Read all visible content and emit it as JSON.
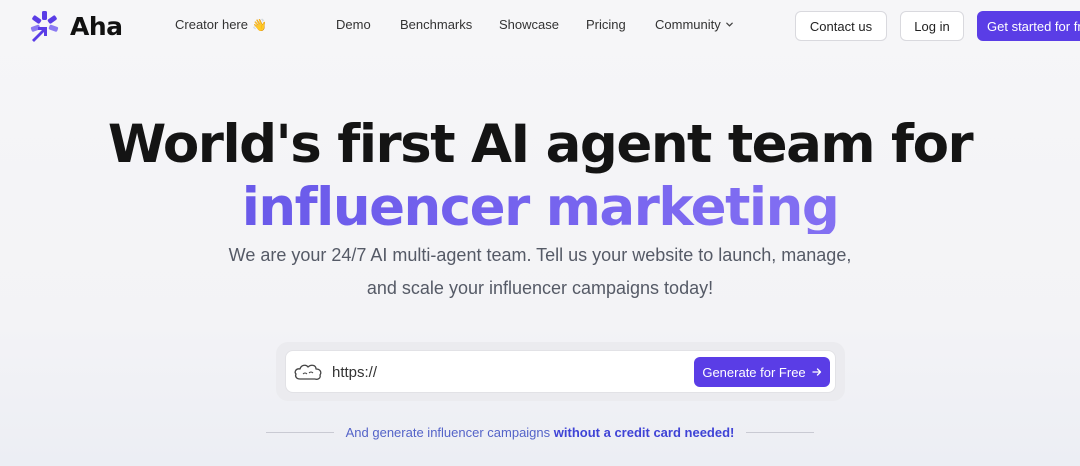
{
  "brand": {
    "name": "Aha"
  },
  "nav": {
    "creator_label": "Creator here",
    "creator_emoji": "👋",
    "demo": "Demo",
    "benchmarks": "Benchmarks",
    "showcase": "Showcase",
    "pricing": "Pricing",
    "community": "Community",
    "contact_button": "Contact us",
    "login_button": "Log in",
    "get_started_button": "Get started for fr"
  },
  "hero": {
    "title_line1": "World's first AI agent team for",
    "title_line2": "influencer marketing",
    "subtitle_line1": "We are your 24/7 AI multi-agent team. Tell us your website to launch, manage,",
    "subtitle_line2": "and scale your influencer campaigns today!"
  },
  "url_form": {
    "value": "https://",
    "icon": "cloud-icon",
    "generate_button": "Generate for Free"
  },
  "footnote": {
    "prefix": "And generate influencer campaigns",
    "emphasis": "without a credit card needed!"
  },
  "colors": {
    "accent": "#5a3de6",
    "gradient_start": "#6052e6",
    "gradient_end": "#8f7cf5",
    "footnote": "#5463c8"
  }
}
